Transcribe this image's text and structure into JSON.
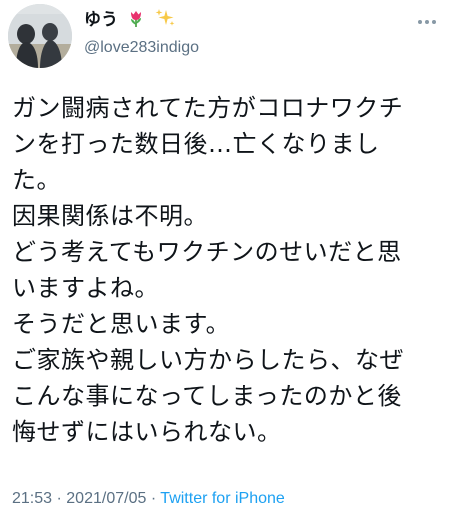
{
  "user": {
    "display_name": "ゆう",
    "handle": "@love283indigo",
    "name_emojis": [
      "tulip-icon",
      "sparkles-icon"
    ],
    "avatar": "avatar-icon"
  },
  "tweet": {
    "lines": [
      "ガン闘病されてた方がコロナワクチ",
      "ンを打った数日後…亡くなりまし",
      "た。",
      "因果関係は不明。",
      "どう考えてもワクチンのせいだと思",
      "いますよね。",
      "そうだと思います。",
      "ご家族や親しい方からしたら、なぜ",
      "こんな事になってしまったのかと後",
      "悔せずにはいられない。"
    ]
  },
  "meta": {
    "time": "21:53",
    "date": "2021/07/05",
    "separator": "·",
    "source": "Twitter for iPhone"
  },
  "colors": {
    "text": "#0f1419",
    "secondary": "#5b7083",
    "link": "#1da1f2"
  },
  "icons": {
    "more": "more-icon"
  }
}
